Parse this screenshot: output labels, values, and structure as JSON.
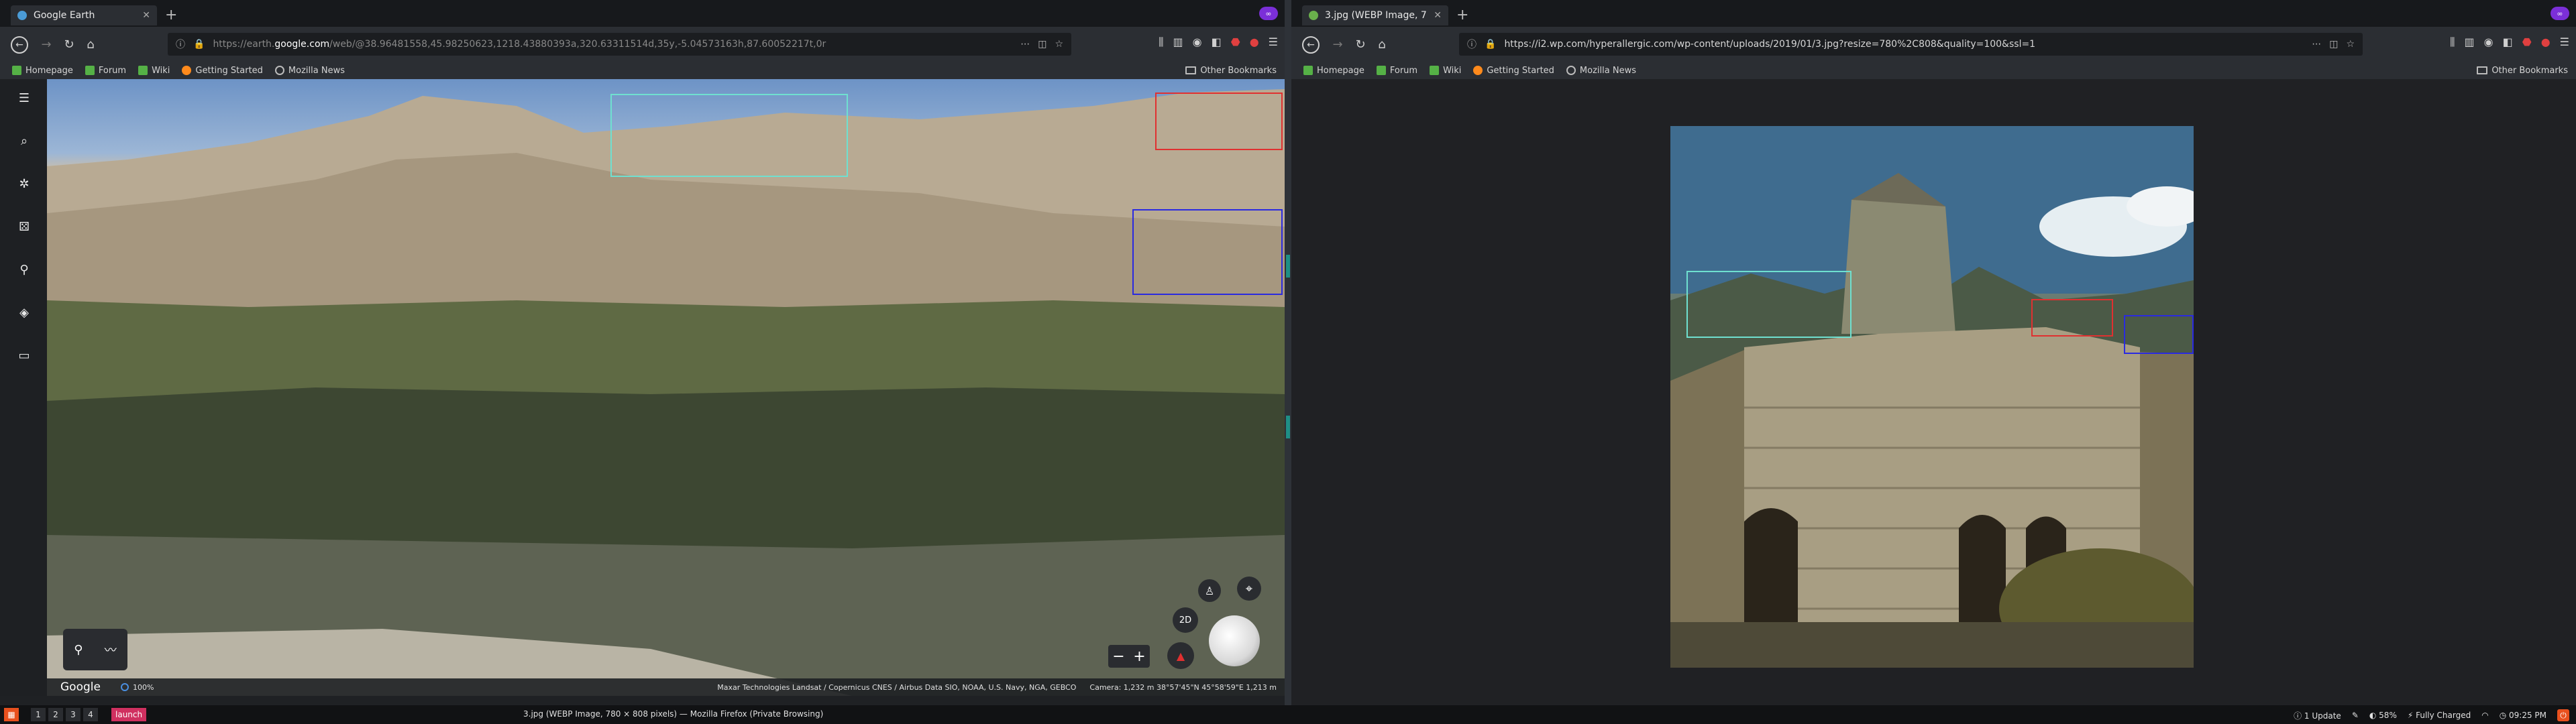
{
  "left_window": {
    "tab_title": "Google Earth",
    "url_prefix": "https://earth.",
    "url_domain": "google.com",
    "url_rest": "/web/@38.96481558,45.98250623,1218.43880393a,320.63311514d,35y,-5.04573163h,87.60052217t,0r",
    "bookmarks": [
      "Homepage",
      "Forum",
      "Wiki",
      "Getting Started",
      "Mozilla News"
    ],
    "other_bookmarks": "Other Bookmarks",
    "earth": {
      "logo": "Google",
      "zoom": "100%",
      "attribution": "Maxar Technologies   Landsat / Copernicus   CNES / Airbus   Data SIO, NOAA, U.S. Navy, NGA, GEBCO",
      "camera": "Camera: 1,232 m   38°57'45\"N 45°58'59\"E   1,213 m",
      "view_mode": "2D"
    }
  },
  "right_window": {
    "tab_title": "3.jpg (WEBP Image, 78...",
    "url": "https://i2.wp.com/hyperallergic.com/wp-content/uploads/2019/01/3.jpg?resize=780%2C808&quality=100&ssl=1",
    "bookmarks": [
      "Homepage",
      "Forum",
      "Wiki",
      "Getting Started",
      "Mozilla News"
    ],
    "other_bookmarks": "Other Bookmarks"
  },
  "taskbar": {
    "workspaces": [
      "1",
      "2",
      "3",
      "4"
    ],
    "launch": "launch",
    "window_title": "3.jpg (WEBP Image, 780 × 808 pixels) — Mozilla Firefox (Private Browsing)",
    "update": "1 Update",
    "volume": "58%",
    "battery": "Fully Charged",
    "time": "09:25 PM"
  },
  "colors": {
    "box_cyan": "#6fe0d0",
    "box_red": "#e03030",
    "box_blue": "#2a2ae0",
    "accent": "#e8501e"
  }
}
